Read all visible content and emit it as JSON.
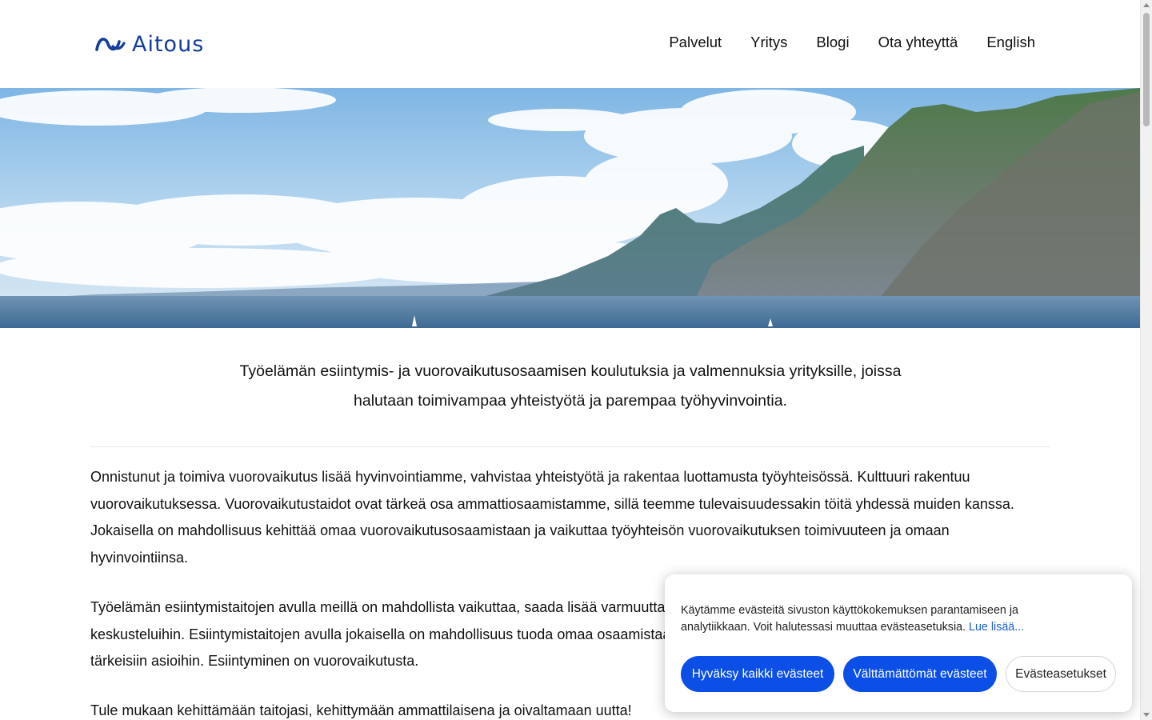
{
  "header": {
    "logo_text": "Aitous",
    "nav": [
      "Palvelut",
      "Yritys",
      "Blogi",
      "Ota yhteyttä",
      "English"
    ]
  },
  "main": {
    "intro_line1": "Työelämän esiintymis- ja vuorovaikutusosaamisen koulutuksia ja valmennuksia yrityksille, joissa",
    "intro_line2": "halutaan toimivampaa yhteistyötä ja parempaa työhyvinvointia.",
    "paragraphs": [
      "Onnistunut ja toimiva vuorovaikutus lisää hyvinvointiamme, vahvistaa yhteistyötä ja rakentaa luottamusta työyhteisössä. Kulttuuri rakentuu vuorovaikutuksessa. Vuorovaikutustaidot ovat tärkeä osa ammattiosaamistamme, sillä teemme tulevaisuudessakin töitä yhdessä muiden kanssa. Jokaisella on mahdollisuus kehittää omaa vuorovaikutusosaamistaan ja vaikuttaa työyhteisön vuorovaikutuksen toimivuuteen ja omaan hyvinvointiinsa.",
      "Työelämän esiintymistaitojen avulla meillä on mahdollista vaikuttaa, saada lisää varmuutta ja rohkeutta ottaa puheenvuoroja ja osallistua yhteisiin keskusteluihin. Esiintymistaitojen avulla jokaisella on mahdollisuus tuoda omaa osaamistaan ja näkemyksiään esiin ja päästä vaikuttamaan itselle tärkeisiin asioihin. Esiintyminen on vuorovaikutusta.",
      "Tule mukaan kehittämään taitojasi, kehittymään ammattilaisena ja oivaltamaan uutta!"
    ]
  },
  "cookie": {
    "text": "Käytämme evästeitä sivuston käyttökokemuksen parantamiseen ja analytiikkaan. Voit halutessasi muuttaa evästeasetuksia.",
    "link": "Lue lisää...",
    "accept_all": "Hyväksy kaikki evästeet",
    "necessary": "Välttämättömät evästeet",
    "settings": "Evästeasetukset"
  },
  "colors": {
    "brand": "#143c9a",
    "primary_button": "#0b4fe6",
    "link": "#1a5fd0"
  }
}
